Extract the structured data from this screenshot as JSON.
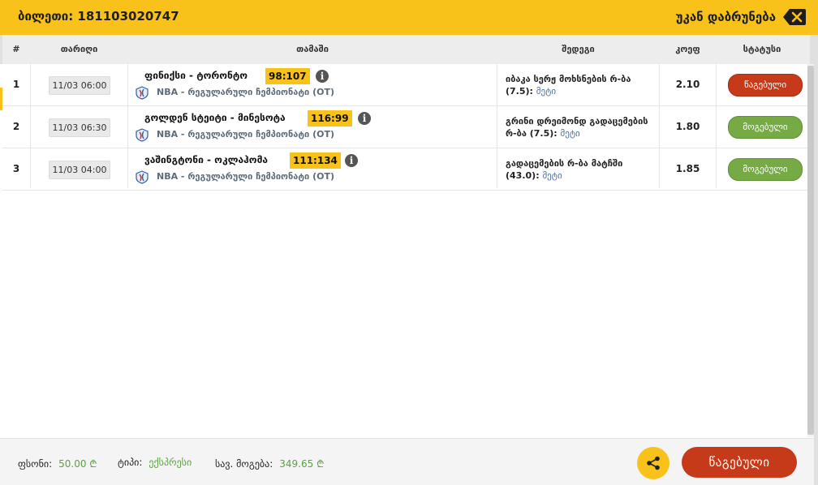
{
  "header": {
    "ticket_title": "ბილეთი: 181103020747",
    "back_label": "უკან დაბრუნება",
    "back_icon": "backspace-icon"
  },
  "columns": {
    "num": "#",
    "date": "თარიღი",
    "event": "თამაში",
    "result": "შედეგი",
    "odds": "კოეფ",
    "status": "სტატუსი"
  },
  "rows": [
    {
      "num": "1",
      "date": "11/03 06:00",
      "teams": "ფინიქსი - ტორონტო",
      "score": "98:107",
      "league": "NBA - რეგულარული ჩემპიონატი (OT)",
      "result": "იბაკა სერჟ მოხსნების რ-ბა (7.5):",
      "result_pick": "მეტი",
      "odds": "2.10",
      "status": "წაგებული",
      "status_type": "lost"
    },
    {
      "num": "2",
      "date": "11/03 06:30",
      "teams": "გოლდენ სტეიტი - მინესოტა",
      "score": "116:99",
      "league": "NBA - რეგულარული ჩემპიონატი (OT)",
      "result": "გრინი დრეიმონდ გადაცემების რ-ბა (7.5):",
      "result_pick": "მეტი",
      "odds": "1.80",
      "status": "მოგებული",
      "status_type": "won"
    },
    {
      "num": "3",
      "date": "11/03 04:00",
      "teams": "ვაშინგტონი - ოკლაჰომა",
      "score": "111:134",
      "league": "NBA - რეგულარული ჩემპიონატი (OT)",
      "result": "გადაცემების რ-ბა მატჩში (43.0):",
      "result_pick": "მეტი",
      "odds": "1.85",
      "status": "მოგებული",
      "status_type": "won"
    }
  ],
  "footer": {
    "stake_label": "ფსონი:",
    "stake_value": "50.00 ₾",
    "type_label": "ტიპი:",
    "type_value": "ექსპრესი",
    "payout_label": "სავ. მოგება:",
    "payout_value": "349.65 ₾",
    "share_icon": "share-icon",
    "status_button": "წაგებული"
  },
  "colors": {
    "accent": "#f8c21b",
    "lost": "#c63a1a",
    "won": "#76aa45",
    "money": "#5da043"
  }
}
